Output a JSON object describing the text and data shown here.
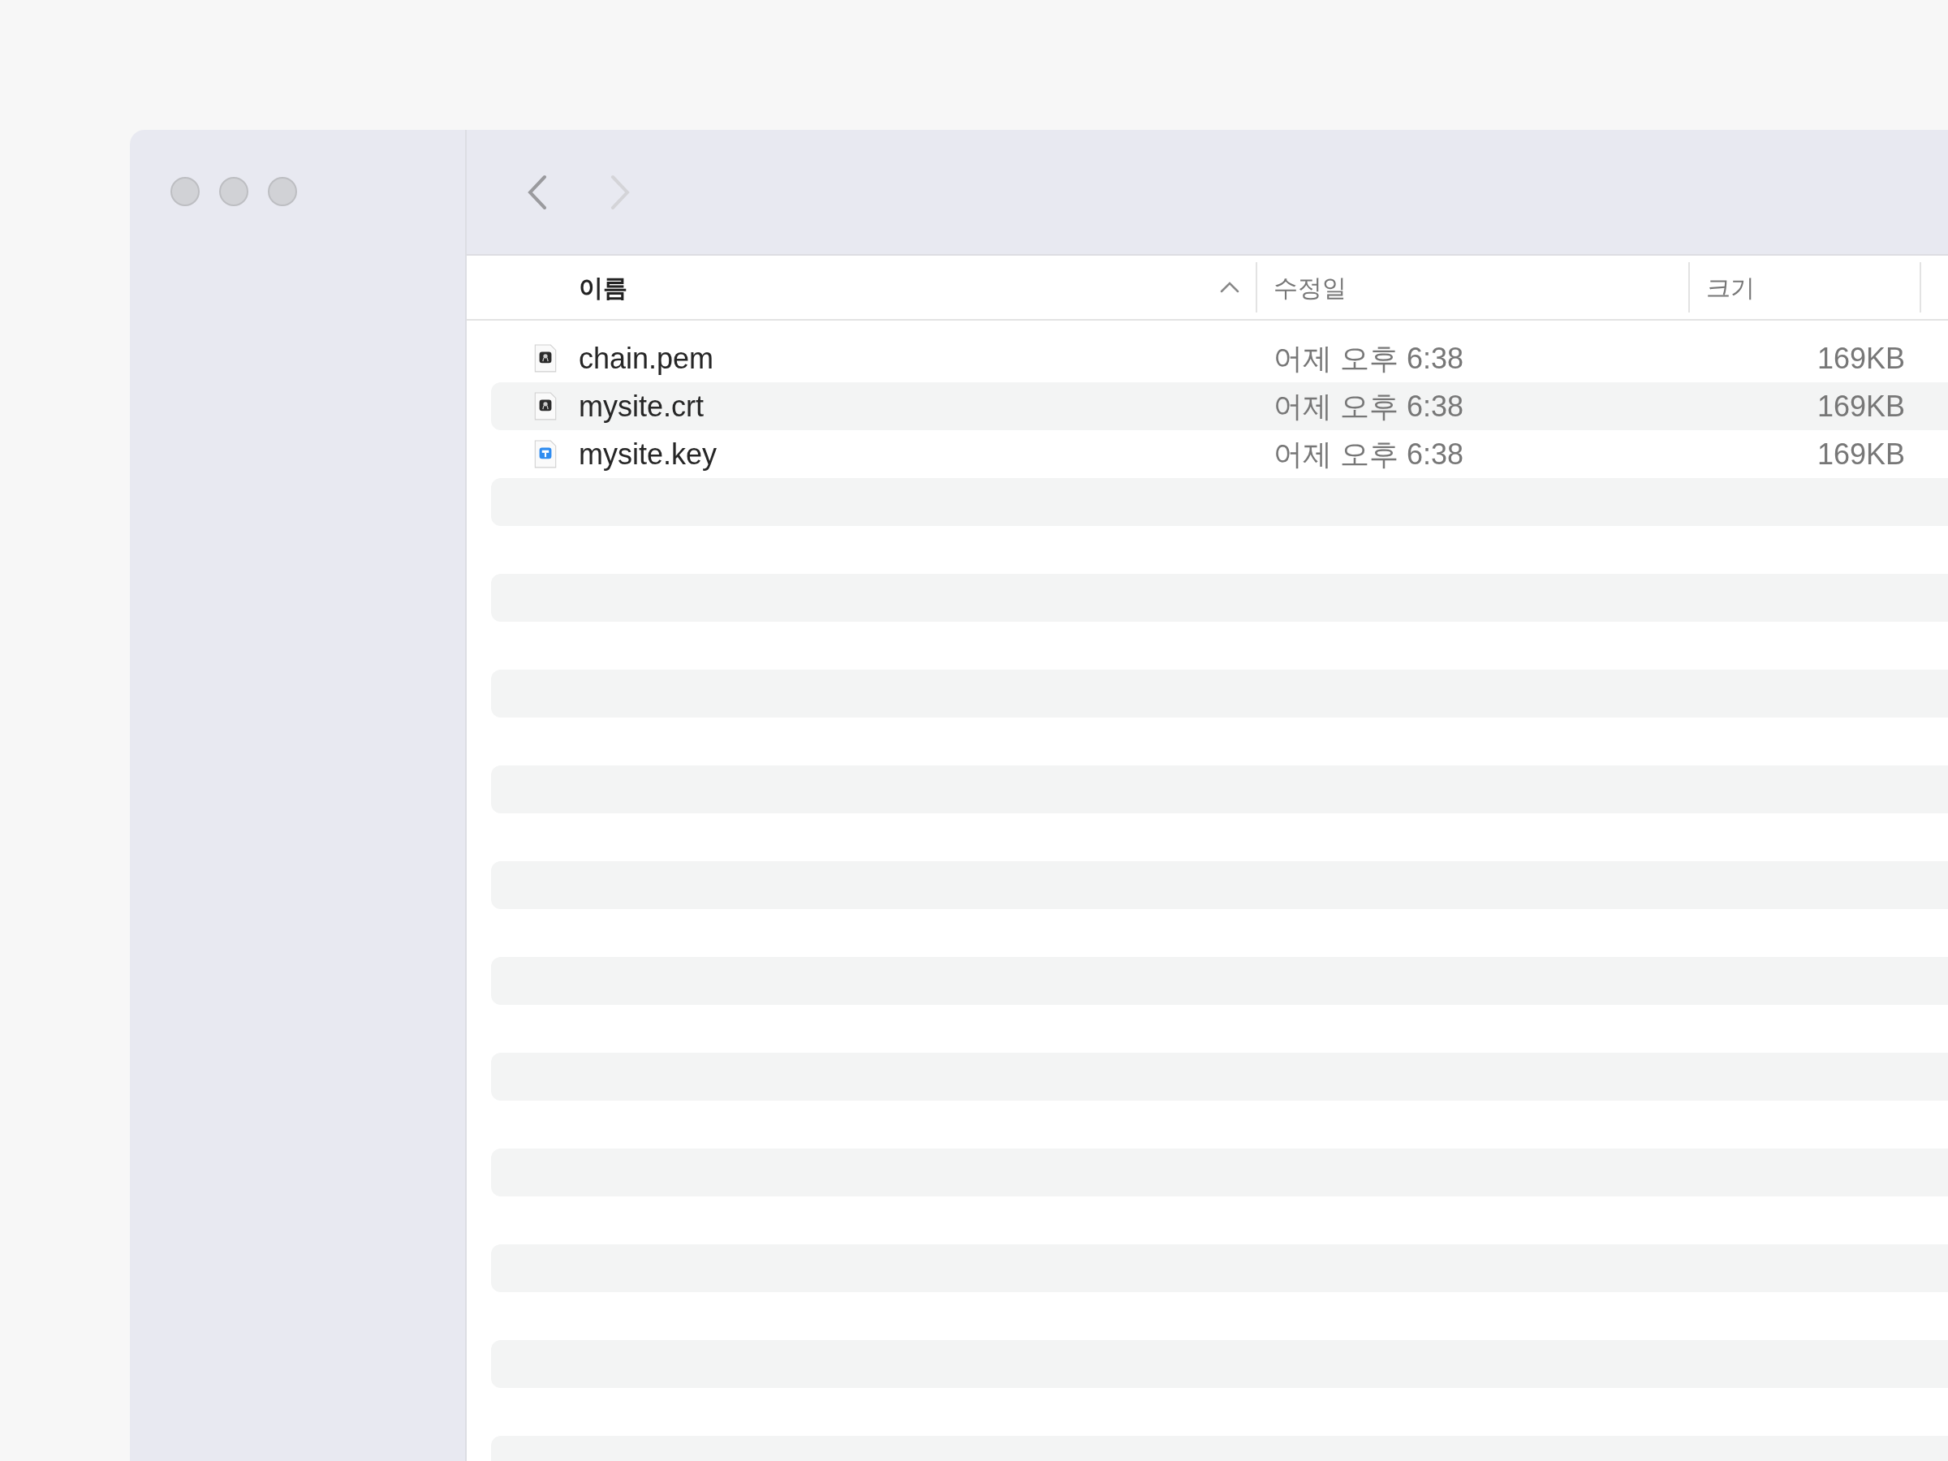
{
  "toolbar": {
    "back": {
      "disabled": false
    },
    "forward": {
      "disabled": true
    }
  },
  "table": {
    "columns": [
      {
        "label": "이름",
        "sorted": true
      },
      {
        "label": "수정일",
        "sorted": false
      },
      {
        "label": "크기",
        "sorted": false
      }
    ],
    "rows": [
      {
        "kind": "certificate",
        "name": "chain.pem",
        "modified": "어제 오후 6:38",
        "size": "169KB"
      },
      {
        "kind": "certificate",
        "name": "mysite.crt",
        "modified": "어제 오후 6:38",
        "size": "169KB"
      },
      {
        "kind": "key",
        "name": "mysite.key",
        "modified": "어제 오후 6:38",
        "size": "169KB"
      }
    ]
  }
}
